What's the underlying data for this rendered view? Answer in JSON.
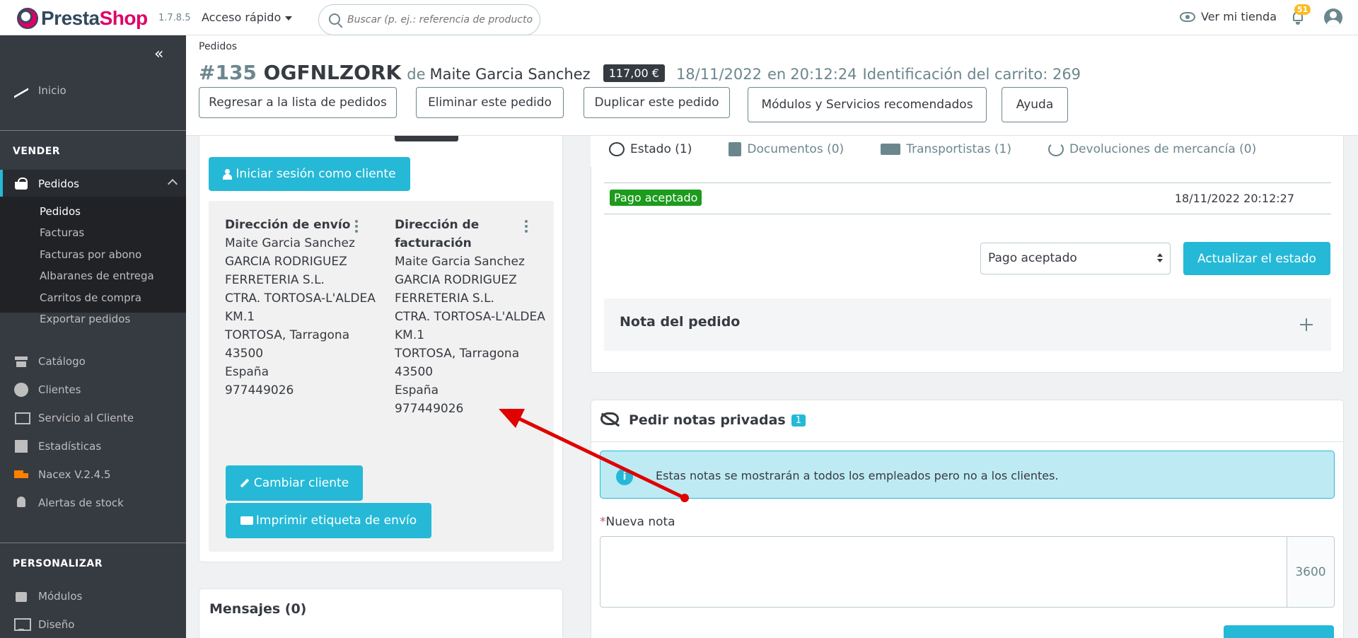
{
  "topbar": {
    "logo_brand_a": "Presta",
    "logo_brand_b": "Shop",
    "version": "1.7.8.5",
    "quick_access": "Acceso rápido",
    "search_placeholder": "Buscar (p. ej.: referencia de producto,",
    "view_shop": "Ver mi tienda",
    "notifications": "51"
  },
  "sidebar": {
    "home": "Inicio",
    "section_sell": "VENDER",
    "orders": "Pedidos",
    "sub_orders": [
      "Pedidos",
      "Facturas",
      "Facturas por abono",
      "Albaranes de entrega",
      "Carritos de compra",
      "Exportar pedidos"
    ],
    "catalog": "Catálogo",
    "customers": "Clientes",
    "customer_service": "Servicio al Cliente",
    "stats": "Estadísticas",
    "nacex": "Nacex V.2.4.5",
    "stock_alerts": "Alertas de stock",
    "section_customize": "PERSONALIZAR",
    "modules": "Módulos",
    "design": "Diseño"
  },
  "header": {
    "breadcrumb": "Pedidos",
    "order_number": "#135",
    "order_ref": "OGFNLZORK",
    "order_of": "de",
    "customer_name": "Maite Garcia Sanchez",
    "total": "117,00 €",
    "date": "18/11/2022",
    "at": "en",
    "time": "20:12:24",
    "cart_id": "Identificación del carrito: 269",
    "buttons": {
      "back": "Regresar a la lista de pedidos",
      "delete": "Eliminar este pedido",
      "duplicate": "Duplicar este pedido",
      "modules": "Módulos y Servicios recomendados",
      "help": "Ayuda"
    }
  },
  "customer_card": {
    "login_as": "Iniciar sesión como cliente",
    "shipping": {
      "title": "Dirección de envío",
      "lines": [
        "Maite Garcia Sanchez",
        "GARCIA RODRIGUEZ",
        "FERRETERIA S.L.",
        "CTRA. TORTOSA-L'ALDEA",
        "KM.1",
        "TORTOSA, Tarragona",
        "43500",
        "España",
        "977449026"
      ]
    },
    "billing": {
      "title_1": "Dirección de",
      "title_2": "facturación",
      "lines": [
        "Maite Garcia Sanchez",
        "GARCIA RODRIGUEZ",
        "FERRETERIA S.L.",
        "CTRA. TORTOSA-L'ALDEA",
        "KM.1",
        "TORTOSA, Tarragona",
        "43500",
        "España",
        "977449026"
      ]
    },
    "change_customer": "Cambiar cliente",
    "print_label": "Imprimir etiqueta de envío"
  },
  "messages": {
    "title": "Mensajes (0)"
  },
  "status_panel": {
    "tabs": [
      "Estado (1)",
      "Documentos (0)",
      "Transportistas (1)",
      "Devoluciones de mercancía (0)"
    ],
    "history": [
      {
        "status": "Pago aceptado",
        "date": "18/11/2022 20:12:27",
        "color": "#1c9b1c"
      }
    ],
    "selected_status": "Pago aceptado",
    "update_button": "Actualizar el estado",
    "order_note": "Nota del pedido"
  },
  "private_notes": {
    "title": "Pedir notas privadas",
    "count": "1",
    "info": "Estas notas se mostrarán a todos los empleados pero no a los clientes.",
    "required_mark": "*",
    "new_note_label": "Nueva nota",
    "char_counter": "3600"
  },
  "colors": {
    "accent": "#25b9d7",
    "sidebar": "#363a41",
    "success": "#1c9b1c",
    "brand": "#df0067",
    "annotation_arrow": "#e00000"
  }
}
